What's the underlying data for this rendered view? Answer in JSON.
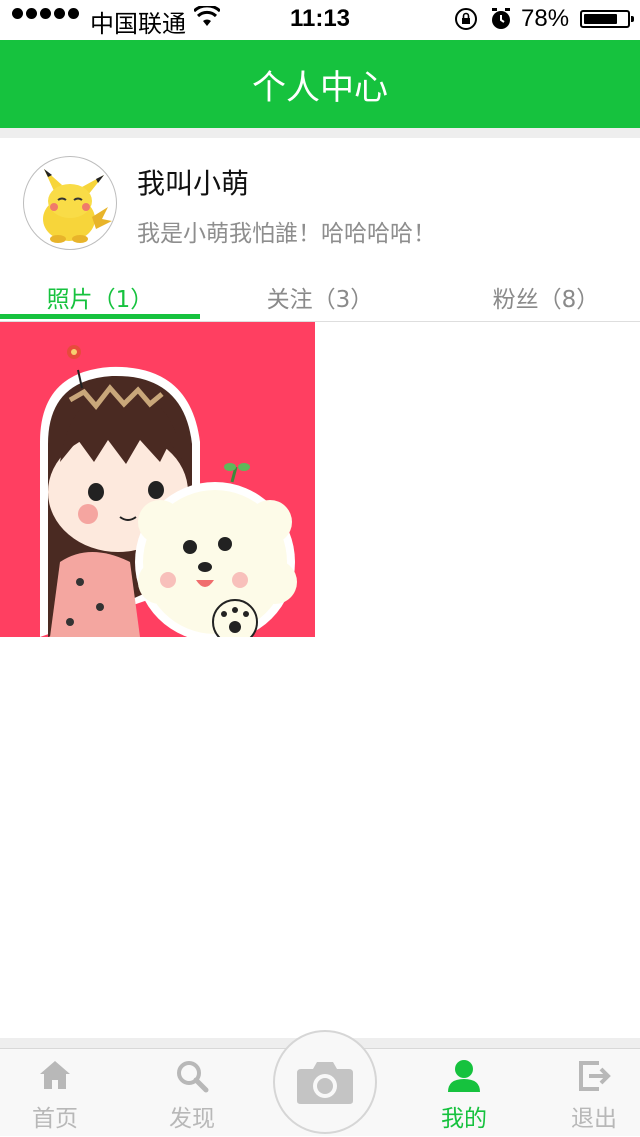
{
  "status_bar": {
    "carrier": "中国联通",
    "time": "11:13",
    "battery_percent_label": "78%",
    "battery_level": 0.78
  },
  "header": {
    "title": "个人中心"
  },
  "profile": {
    "name": "我叫小萌",
    "bio": "我是小萌我怕誰！哈哈哈哈！",
    "avatar_icon": "pikachu-avatar"
  },
  "tabs": [
    {
      "label": "照片（1）",
      "active": true
    },
    {
      "label": "关注（3）",
      "active": false
    },
    {
      "label": "粉丝（8）",
      "active": false
    }
  ],
  "photos": [
    {
      "icon": "girl-with-puppy-illustration",
      "background": "#ff3f61"
    }
  ],
  "tabbar": {
    "items": [
      {
        "label": "首页",
        "icon": "home-icon",
        "active": false
      },
      {
        "label": "发现",
        "icon": "search-icon",
        "active": false
      },
      {
        "label": "我的",
        "icon": "user-icon",
        "active": true
      },
      {
        "label": "退出",
        "icon": "logout-icon",
        "active": false
      }
    ],
    "center_icon": "camera-icon"
  },
  "colors": {
    "accent": "#16c23e",
    "inactive": "#b8b8b8",
    "photo_bg": "#ff3f61"
  }
}
